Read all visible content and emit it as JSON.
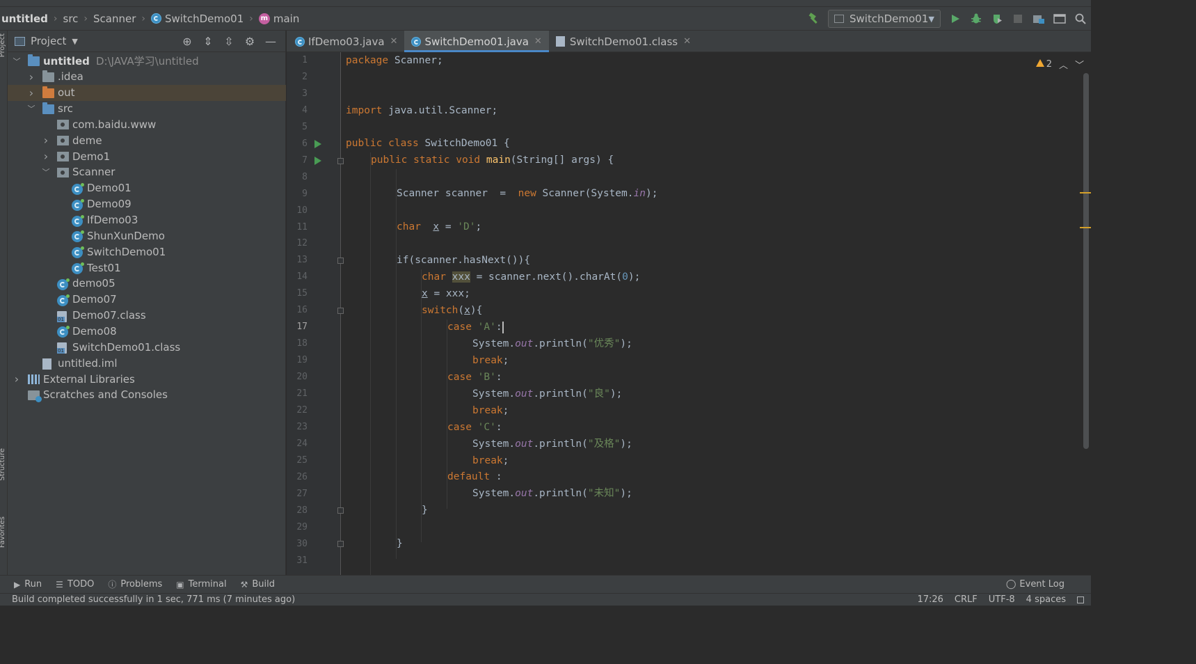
{
  "breadcrumb": {
    "project": "untitled",
    "src": "src",
    "package": "Scanner",
    "class": "SwitchDemo01",
    "method": "main",
    "method_icon": "m"
  },
  "toolbar": {
    "run_config": "SwitchDemo01",
    "icons": [
      "hammer-icon",
      "run-icon",
      "debug-icon",
      "coverage-icon",
      "stop-icon",
      "project-structure-icon",
      "window-icon",
      "search-icon"
    ]
  },
  "left_stripe": {
    "project": "Project",
    "structure": "Structure",
    "favorites": "Favorites"
  },
  "project_panel": {
    "title": "Project",
    "tree": [
      {
        "label": "untitled",
        "path": "D:\\JAVA学习\\untitled",
        "indent": 0,
        "expand": "open",
        "icon": "module"
      },
      {
        "label": ".idea",
        "indent": 1,
        "expand": "closed",
        "icon": "folder"
      },
      {
        "label": "out",
        "indent": 1,
        "expand": "closed",
        "icon": "folder-orange",
        "selected": true
      },
      {
        "label": "src",
        "indent": 1,
        "expand": "open",
        "icon": "folder-blue"
      },
      {
        "label": "com.baidu.www",
        "indent": 2,
        "expand": "none",
        "icon": "package"
      },
      {
        "label": "deme",
        "indent": 2,
        "expand": "closed",
        "icon": "package"
      },
      {
        "label": "Demo1",
        "indent": 2,
        "expand": "closed",
        "icon": "package"
      },
      {
        "label": "Scanner",
        "indent": 2,
        "expand": "open",
        "icon": "package"
      },
      {
        "label": "Demo01",
        "indent": 3,
        "expand": "none",
        "icon": "class"
      },
      {
        "label": "Demo09",
        "indent": 3,
        "expand": "none",
        "icon": "class"
      },
      {
        "label": "IfDemo03",
        "indent": 3,
        "expand": "none",
        "icon": "class"
      },
      {
        "label": "ShunXunDemo",
        "indent": 3,
        "expand": "none",
        "icon": "class"
      },
      {
        "label": "SwitchDemo01",
        "indent": 3,
        "expand": "none",
        "icon": "class"
      },
      {
        "label": "Test01",
        "indent": 3,
        "expand": "none",
        "icon": "class"
      },
      {
        "label": "demo05",
        "indent": 2,
        "expand": "none",
        "icon": "class"
      },
      {
        "label": "Demo07",
        "indent": 2,
        "expand": "none",
        "icon": "class"
      },
      {
        "label": "Demo07.class",
        "indent": 2,
        "expand": "none",
        "icon": "classfile"
      },
      {
        "label": "Demo08",
        "indent": 2,
        "expand": "none",
        "icon": "class"
      },
      {
        "label": "SwitchDemo01.class",
        "indent": 2,
        "expand": "none",
        "icon": "classfile"
      },
      {
        "label": "untitled.iml",
        "indent": 1,
        "expand": "none",
        "icon": "iml"
      },
      {
        "label": "External Libraries",
        "indent": 0,
        "expand": "closed",
        "icon": "library"
      },
      {
        "label": "Scratches and Consoles",
        "indent": 0,
        "expand": "none",
        "icon": "scratch"
      }
    ]
  },
  "tabs": [
    {
      "label": "IfDemo03.java",
      "icon": "class",
      "active": false
    },
    {
      "label": "SwitchDemo01.java",
      "icon": "class",
      "active": true
    },
    {
      "label": "SwitchDemo01.class",
      "icon": "classfile",
      "active": false
    }
  ],
  "editor": {
    "warning_count": "2",
    "current_line": 17,
    "line_numbers": [
      "1",
      "2",
      "3",
      "4",
      "5",
      "6",
      "7",
      "8",
      "9",
      "10",
      "11",
      "12",
      "13",
      "14",
      "15",
      "16",
      "17",
      "18",
      "19",
      "20",
      "21",
      "22",
      "23",
      "24",
      "25",
      "26",
      "27",
      "28",
      "29",
      "30",
      "31"
    ],
    "code": {
      "l1_kw": "package",
      "l1_rest": " Scanner;",
      "l4_kw": "import",
      "l4_rest": " java.util.Scanner;",
      "l6_kw": "public class",
      "l6_rest": " SwitchDemo01 {",
      "l7_kw": "public static void",
      "l7_fn": "main",
      "l7_rest": "(String[] args) {",
      "l9_a": "Scanner scanner  =  ",
      "l9_kw": "new",
      "l9_b": " Scanner(System.",
      "l9_st": "in",
      "l9_c": ");",
      "l11_kw": "char",
      "l11_var": "x",
      "l11_eq": " = ",
      "l11_str": "'D'",
      "l11_end": ";",
      "l13": "if(scanner.hasNext()){",
      "l14_kw": "char",
      "l14_var": "xxx",
      "l14_a": " = scanner.next().charAt(",
      "l14_num": "0",
      "l14_b": ");",
      "l15_var": "x",
      "l15_rest": " = xxx;",
      "l16_kw": "switch",
      "l16_a": "(",
      "l16_var": "x",
      "l16_b": "){",
      "case_kw": "case",
      "l17_str": "'A'",
      "l17_rest": ":",
      "sys": "System.",
      "out": "out",
      "println": ".println(",
      "l18_str": "\"优秀\"",
      "end_call": ");",
      "break_kw": "break",
      "semi": ";",
      "l20_str": "'B'",
      "colon": ":",
      "l21_str": "\"良\"",
      "l23_str": "'C'",
      "l24_str": "\"及格\"",
      "default_kw": "default",
      "default_rest": " :",
      "l27_str": "\"未知\"",
      "brace": "}"
    }
  },
  "bottom_tools": {
    "run": "Run",
    "todo": "TODO",
    "problems": "Problems",
    "terminal": "Terminal",
    "build": "Build",
    "event_log": "Event Log"
  },
  "status": {
    "message": "Build completed successfully in 1 sec, 771 ms (7 minutes ago)",
    "position": "17:26",
    "line_sep": "CRLF",
    "encoding": "UTF-8",
    "indent": "4 spaces"
  }
}
